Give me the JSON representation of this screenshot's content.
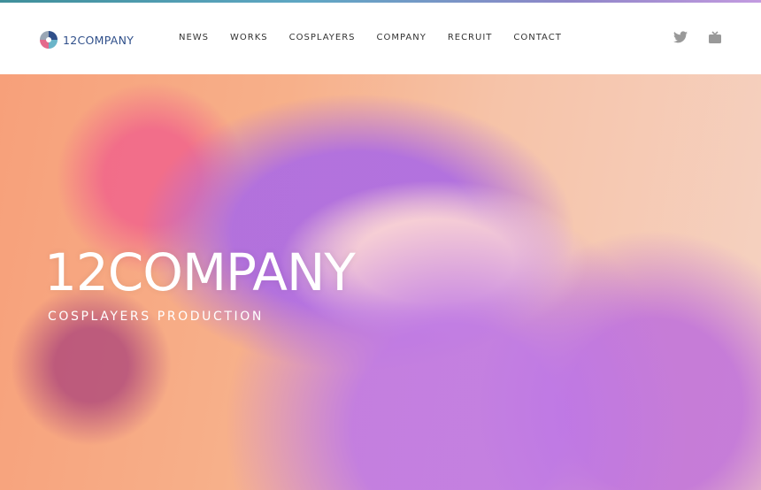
{
  "brand": {
    "name": "12COMPANY"
  },
  "nav": {
    "items": [
      {
        "label": "NEWS"
      },
      {
        "label": "WORKS"
      },
      {
        "label": "COSPLAYERS"
      },
      {
        "label": "COMPANY"
      },
      {
        "label": "RECRUIT"
      },
      {
        "label": "CONTACT"
      }
    ]
  },
  "social": [
    {
      "icon": "twitter-icon",
      "color": "#999999"
    },
    {
      "icon": "tv-icon",
      "color": "#999999"
    }
  ],
  "hero": {
    "title": "12COMPANY",
    "subtitle": "COSPLAYERS PRODUCTION"
  },
  "colors": {
    "brand_text": "#2f4f8a",
    "nav_text": "#333333",
    "top_strip": [
      "#3f8f9a",
      "#c39be0"
    ]
  }
}
